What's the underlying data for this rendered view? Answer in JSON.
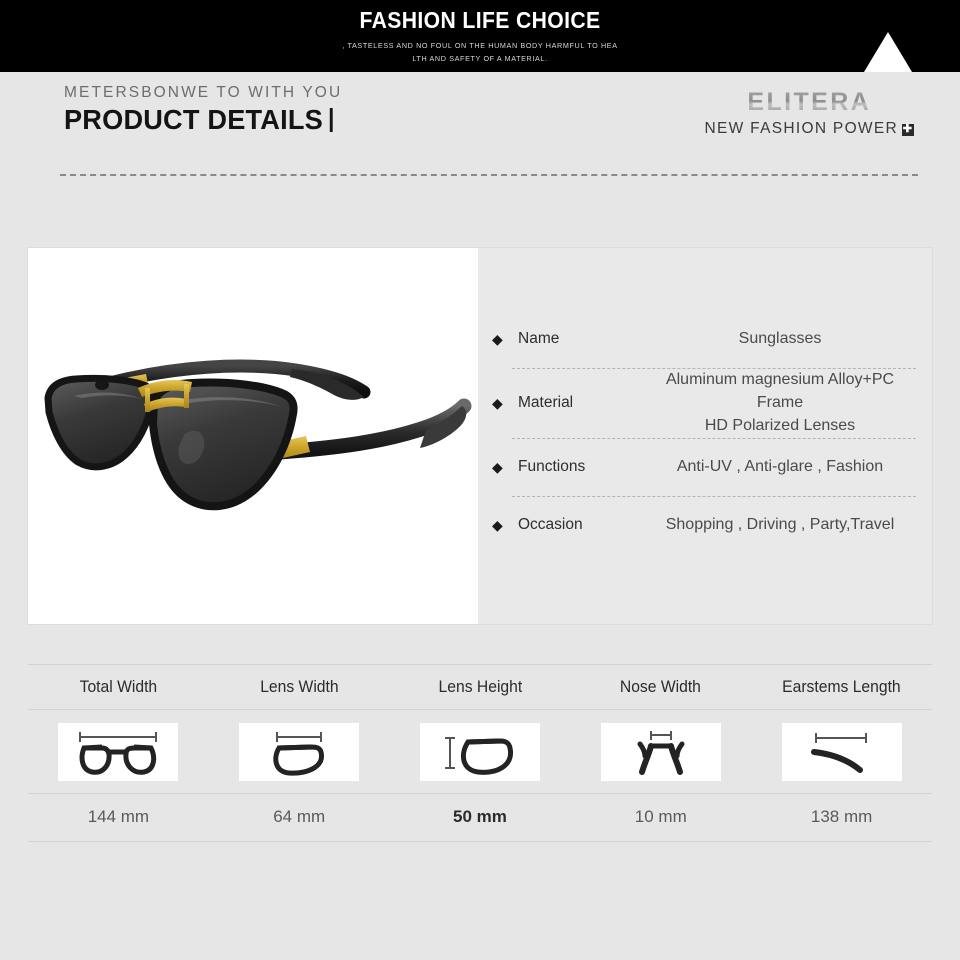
{
  "banner": {
    "title": "FASHION LIFE CHOICE",
    "subtitle_line1": ", TASTELESS AND NO FOUL ON THE HUMAN BODY HARMFUL TO HEA",
    "subtitle_line2": "LTH AND SAFETY OF A MATERIAL.",
    "triangle_color": "#ffffff",
    "background_color": "#000000"
  },
  "header": {
    "eyebrow": "METERSBONWE TO WITH YOU",
    "title": "PRODUCT DETAILS",
    "brand_name": "ELITERA",
    "brand_tagline": "NEW FASHION POWER",
    "brand_plus_glyph": "✚"
  },
  "product": {
    "photo_alt": "black-gold-aviator-sunglasses",
    "frame_color": "#1c1c1c",
    "accent_color": "#c9a227",
    "lens_color": "#3b3b3b",
    "specs": [
      {
        "bullet": "◆",
        "label": "Name",
        "value": "Sunglasses",
        "value_line2": ""
      },
      {
        "bullet": "◆",
        "label": "Material",
        "value": "Aluminum magnesium Alloy+PC Frame",
        "value_line2": "HD Polarized Lenses"
      },
      {
        "bullet": "◆",
        "label": "Functions",
        "value": "Anti-UV , Anti-glare , Fashion",
        "value_line2": ""
      },
      {
        "bullet": "◆",
        "label": "Occasion",
        "value": "Shopping , Driving , Party,Travel",
        "value_line2": ""
      }
    ]
  },
  "measurements": {
    "headers": [
      "Total Width",
      "Lens Width",
      "Lens Height",
      "Nose Width",
      "Earstems Length"
    ],
    "icons": [
      "total-width-diagram",
      "lens-width-diagram",
      "lens-height-diagram",
      "nose-width-diagram",
      "earstems-length-diagram"
    ],
    "values": [
      "144 mm",
      "64 mm",
      "50 mm",
      "10 mm",
      "138 mm"
    ],
    "emphasis_index": 2
  }
}
